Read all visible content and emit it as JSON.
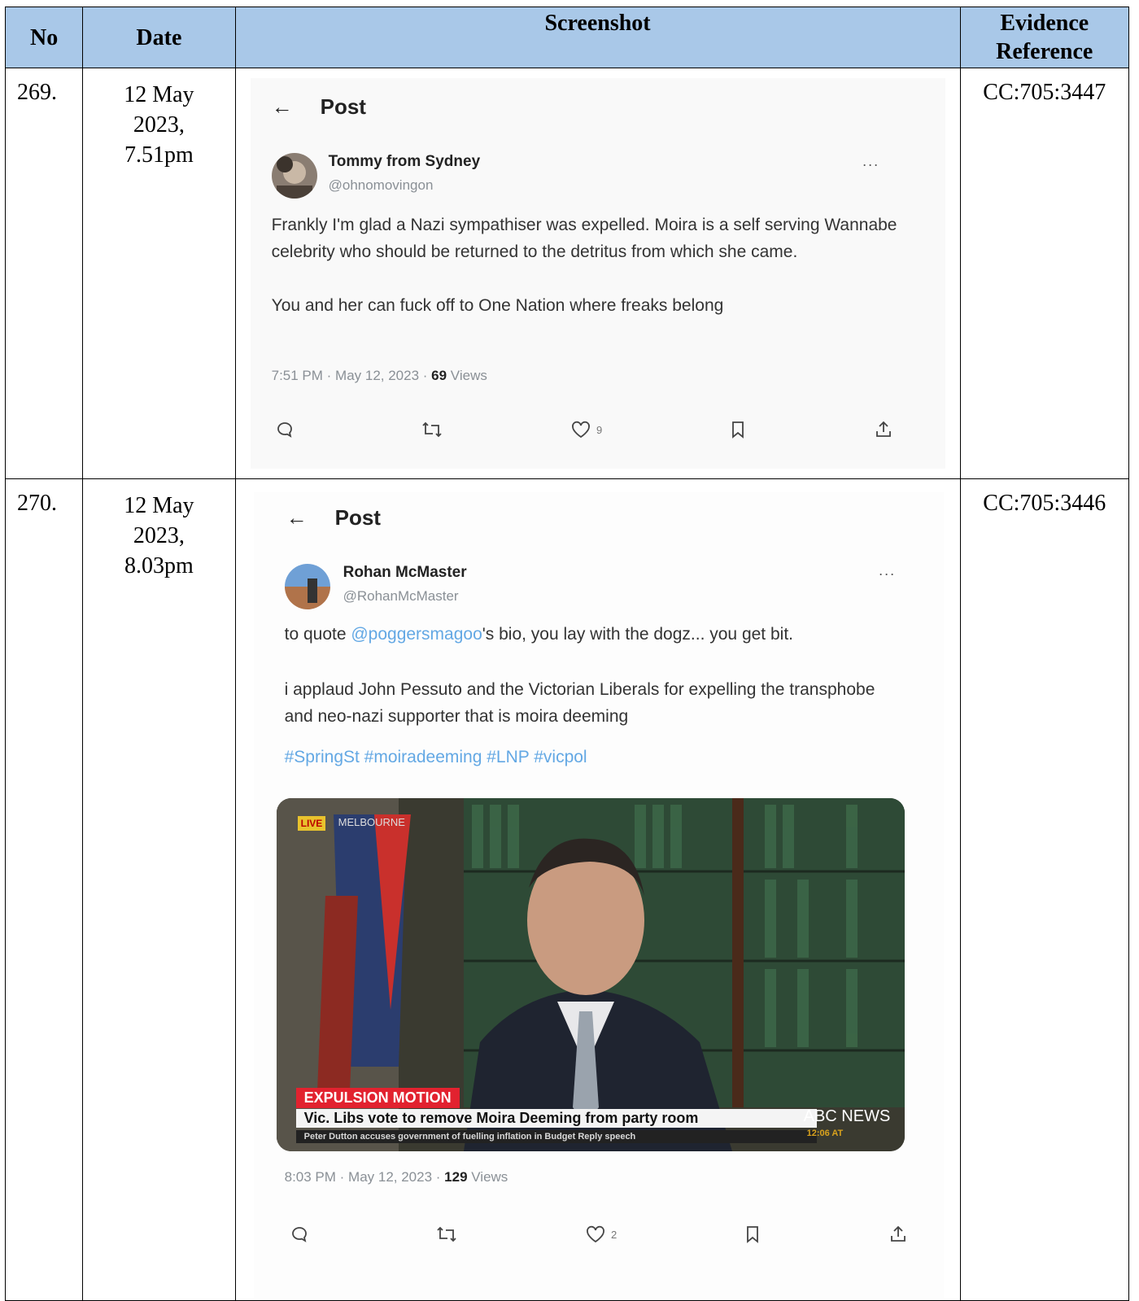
{
  "header": {
    "no": "No",
    "date": "Date",
    "screenshot": "Screenshot",
    "evidence": "Evidence Reference"
  },
  "rows": [
    {
      "no": "269.",
      "date": "12 May 2023, 7.51pm",
      "evidence": "CC:705:3447",
      "tweet": {
        "back": "←",
        "title": "Post",
        "name": "Tommy from Sydney",
        "handle": "@ohnomovingon",
        "more": "···",
        "text": "Frankly I'm glad a Nazi sympathiser was expelled. Moira is a self serving Wannabe celebrity who should be returned to the detritus from which she came.\n\nYou and her can fuck off to One Nation where freaks belong",
        "meta_time": "7:51 PM · May 12, 2023 · ",
        "meta_views": "69",
        "meta_views_label": " Views",
        "likes": "9"
      }
    },
    {
      "no": "270.",
      "date": "12 May 2023, 8.03pm",
      "evidence": "CC:705:3446",
      "tweet": {
        "back": "←",
        "title": "Post",
        "name": "Rohan McMaster",
        "handle": "@RohanMcMaster",
        "more": "···",
        "text_prefix": "to quote ",
        "text_mention": "@poggersmagoo",
        "text_suffix": "'s bio, you lay with the dogz... you get bit.",
        "text2": "i applaud John Pessuto and the Victorian Liberals for expelling the transphobe and neo-nazi supporter that is moira deeming",
        "hashtags": "#SpringSt #moiradeeming #LNP #vicpol",
        "media": {
          "live": "LIVE",
          "city": "MELBOURNE",
          "chyron_red": "EXPULSION MOTION",
          "chyron_white": "Vic. Libs vote to remove Moira Deeming from party room",
          "chyron_strip": "Peter Dutton accuses government of fuelling inflation in Budget Reply speech",
          "logo": "ABC NEWS",
          "time": "12:06 AT"
        },
        "meta_time": "8:03 PM · May 12, 2023 · ",
        "meta_views": "129",
        "meta_views_label": " Views",
        "likes": "2"
      }
    }
  ]
}
